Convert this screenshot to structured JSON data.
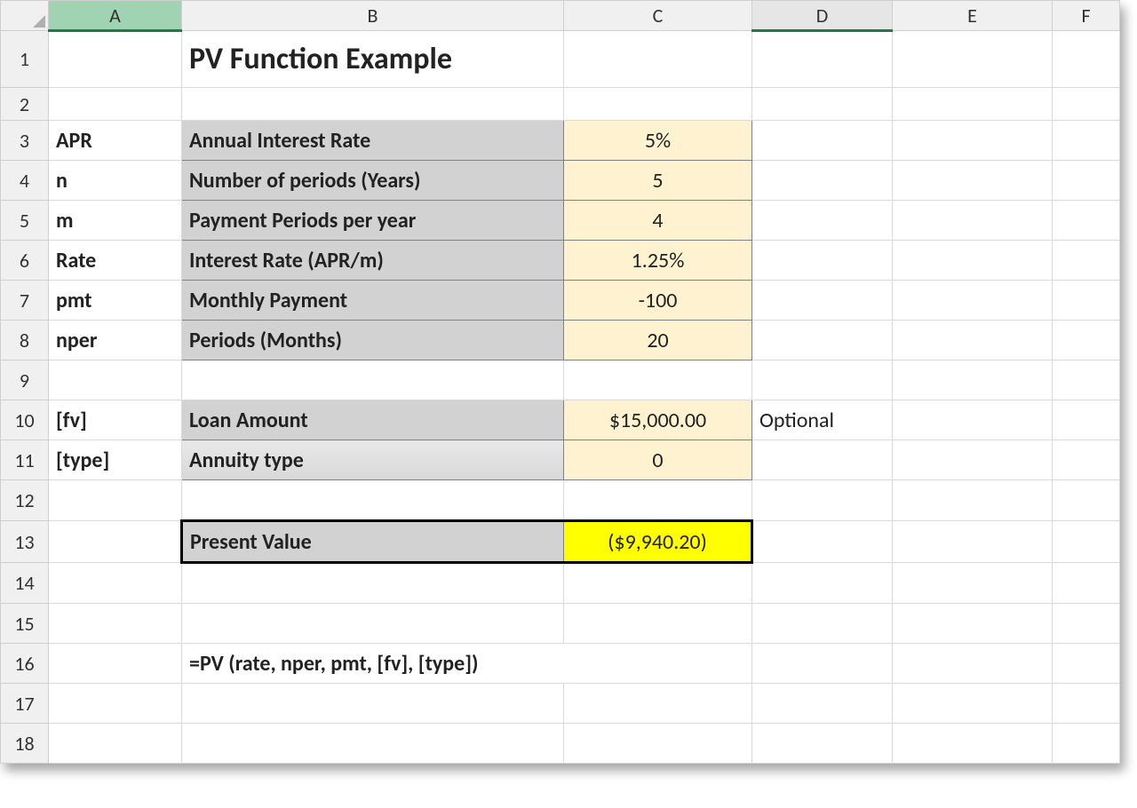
{
  "columns": {
    "A": "A",
    "B": "B",
    "C": "C",
    "D": "D",
    "E": "E",
    "F": "F"
  },
  "rows": {
    "r1": "1",
    "r2": "2",
    "r3": "3",
    "r4": "4",
    "r5": "5",
    "r6": "6",
    "r7": "7",
    "r8": "8",
    "r9": "9",
    "r10": "10",
    "r11": "11",
    "r12": "12",
    "r13": "13",
    "r14": "14",
    "r15": "15",
    "r16": "16",
    "r17": "17",
    "r18": "18"
  },
  "title": "PV Function Example",
  "labelsA": {
    "r3": "APR",
    "r4": "n",
    "r5": "m",
    "r6": "Rate",
    "r7": "pmt",
    "r8": "nper",
    "r10": "[fv]",
    "r11": "[type]"
  },
  "labelsB": {
    "r3": "Annual Interest Rate",
    "r4": "Number of periods (Years)",
    "r5": "Payment Periods per year",
    "r6": "Interest Rate (APR/m)",
    "r7": "Monthly Payment",
    "r8": "Periods (Months)",
    "r10": "Loan Amount",
    "r11": "Annuity type",
    "r13": "Present Value"
  },
  "valuesC": {
    "r3": "5%",
    "r4": "5",
    "r5": "4",
    "r6": "1.25%",
    "r7": "-100",
    "r8": "20",
    "r10": "$15,000.00",
    "r11": "0",
    "r13": "($9,940.20)"
  },
  "valuesD": {
    "r10": "Optional"
  },
  "formula": "=PV (rate, nper, pmt, [fv], [type])",
  "chart_data": {
    "type": "table",
    "title": "PV Function Example",
    "rows": [
      {
        "arg": "APR",
        "description": "Annual Interest Rate",
        "value": "5%"
      },
      {
        "arg": "n",
        "description": "Number of periods (Years)",
        "value": 5
      },
      {
        "arg": "m",
        "description": "Payment Periods per year",
        "value": 4
      },
      {
        "arg": "Rate",
        "description": "Interest Rate (APR/m)",
        "value": "1.25%"
      },
      {
        "arg": "pmt",
        "description": "Monthly Payment",
        "value": -100
      },
      {
        "arg": "nper",
        "description": "Periods (Months)",
        "value": 20
      },
      {
        "arg": "[fv]",
        "description": "Loan Amount",
        "value": 15000.0,
        "note": "Optional"
      },
      {
        "arg": "[type]",
        "description": "Annuity type",
        "value": 0
      }
    ],
    "result": {
      "label": "Present Value",
      "value": -9940.2,
      "display": "($9,940.20)"
    },
    "formula": "=PV (rate, nper, pmt, [fv], [type])"
  }
}
